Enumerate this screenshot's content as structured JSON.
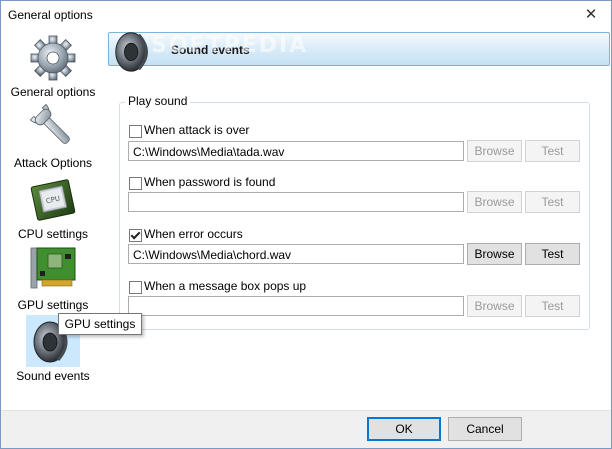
{
  "window": {
    "title": "General options",
    "close_glyph": "✕"
  },
  "sidebar": {
    "items": [
      {
        "label": "General options",
        "icon": "gear-icon"
      },
      {
        "label": "Attack Options",
        "icon": "wrench-icon"
      },
      {
        "label": "CPU settings",
        "icon": "cpu-chip-icon"
      },
      {
        "label": "GPU settings",
        "icon": "gpu-card-icon"
      },
      {
        "label": "Sound events",
        "icon": "speaker-icon",
        "selected": true
      }
    ]
  },
  "tooltip": {
    "text": "GPU settings"
  },
  "header": {
    "title": "Sound events",
    "icon": "speaker-icon",
    "watermark": "SOFTPEDIA"
  },
  "group": {
    "legend": "Play sound",
    "events": [
      {
        "label": "When attack is over",
        "checked": false,
        "path": "C:\\Windows\\Media\\tada.wav",
        "browse": "Browse",
        "test": "Test",
        "enabled": false
      },
      {
        "label": "When password is found",
        "checked": false,
        "path": "",
        "browse": "Browse",
        "test": "Test",
        "enabled": false
      },
      {
        "label": "When error occurs",
        "checked": true,
        "path": "C:\\Windows\\Media\\chord.wav",
        "browse": "Browse",
        "test": "Test",
        "enabled": true
      },
      {
        "label": "When a message box pops up",
        "checked": false,
        "path": "",
        "browse": "Browse",
        "test": "Test",
        "enabled": false
      }
    ]
  },
  "footer": {
    "ok_label": "OK",
    "cancel_label": "Cancel"
  },
  "colors": {
    "header_gradient_top": "#f4fafe",
    "header_gradient_bottom": "#c5e1f4",
    "selected_item": "#cce8ff",
    "accent": "#0078d7"
  }
}
